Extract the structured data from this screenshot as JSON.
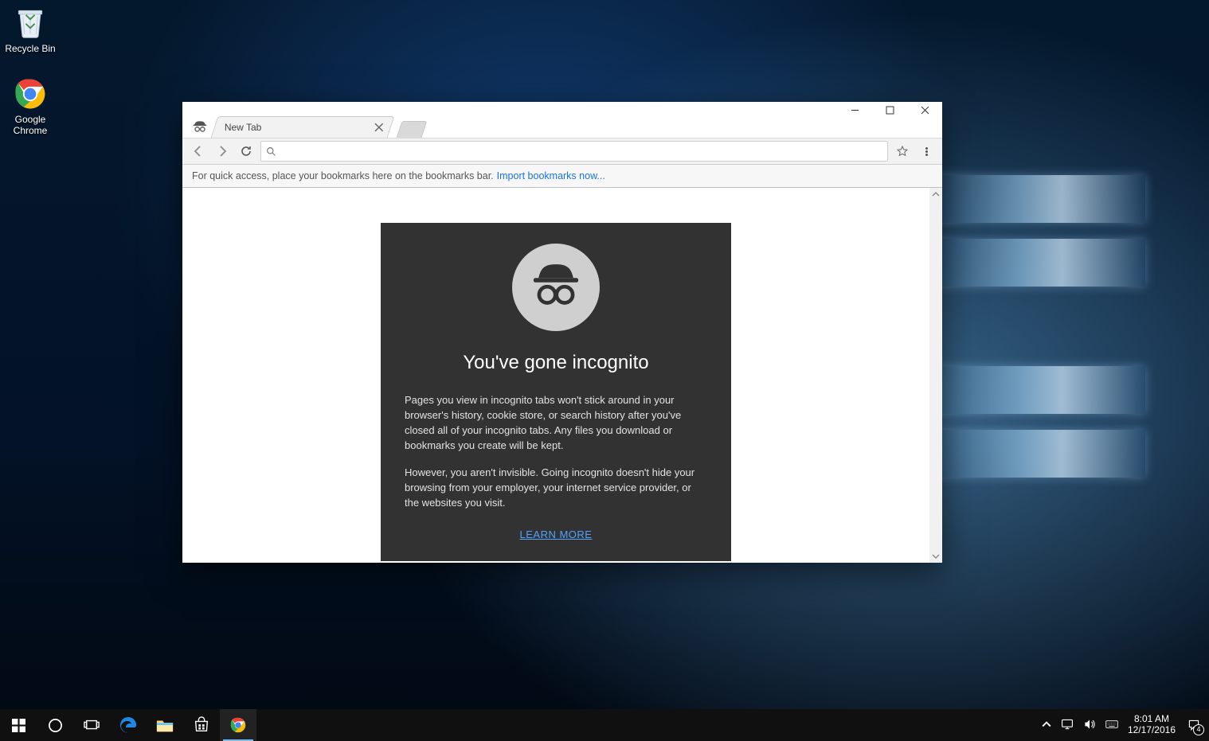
{
  "desktop": {
    "recycle_bin_label": "Recycle Bin",
    "chrome_label": "Google Chrome"
  },
  "chrome": {
    "tab_title": "New Tab",
    "address_value": "",
    "bookmarks_hint": "For quick access, place your bookmarks here on the bookmarks bar.",
    "bookmarks_link": "Import bookmarks now...",
    "incognito": {
      "title": "You've gone incognito",
      "p1": "Pages you view in incognito tabs won't stick around in your browser's history, cookie store, or search history after you've closed all of your incognito tabs. Any files you download or bookmarks you create will be kept.",
      "p2": "However, you aren't invisible. Going incognito doesn't hide your browsing from your employer, your internet service provider, or the websites you visit.",
      "learn_more": "LEARN MORE"
    }
  },
  "taskbar": {
    "time": "8:01 AM",
    "date": "12/17/2016",
    "action_center_count": "4"
  }
}
